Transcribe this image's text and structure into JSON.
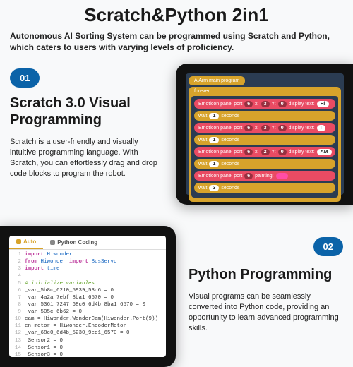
{
  "title": "Scratch&Python 2in1",
  "subtitle": "Autonomous AI Sorting System can be programmed using Scratch and Python, which caters to users with varying levels of proficiency.",
  "section1": {
    "badge": "01",
    "heading": "Scratch 3.0 Visual Programming",
    "body": "Scratch is a user-friendly and visually intuitive programming language. With Scratch, you can effortlessly drag and drop code blocks to program the robot."
  },
  "scratch": {
    "program_title": "AiArm main program",
    "forever": "forever",
    "blocks": [
      {
        "type": "emoticon",
        "port": "6",
        "x": "3",
        "y": "0",
        "text_label": "display text:",
        "text": "Hi"
      },
      {
        "type": "wait",
        "secs": "1"
      },
      {
        "type": "emoticon",
        "port": "6",
        "x": "3",
        "y": "0",
        "text_label": "display text:",
        "text": "I"
      },
      {
        "type": "wait",
        "secs": "1"
      },
      {
        "type": "emoticon",
        "port": "6",
        "x": "2",
        "y": "0",
        "text_label": "display text:",
        "text": "AM"
      },
      {
        "type": "wait",
        "secs": "1"
      },
      {
        "type": "paint",
        "port": "6",
        "label": "painting:"
      },
      {
        "type": "wait",
        "secs": "3"
      }
    ],
    "emoticon_label": "Emoticon panel port",
    "wait_label": "wait",
    "seconds_label": "seconds"
  },
  "python": {
    "tabs": {
      "auto": "Auto",
      "coding": "Python Coding"
    },
    "lines": [
      {
        "n": "1",
        "kw": "import",
        "rest": " Hiwonder"
      },
      {
        "n": "2",
        "kw": "from",
        "mid": " Hiwonder ",
        "kw2": "import",
        "rest2": " BusServo"
      },
      {
        "n": "3",
        "kw": "import",
        "rest": " time"
      },
      {
        "n": "4",
        "plain": ""
      },
      {
        "n": "5",
        "com": "# initialize variables"
      },
      {
        "n": "6",
        "plain": "_var_5b8c_6210_5939_53d6 = 0"
      },
      {
        "n": "7",
        "plain": "_var_4a2a_7ebf_8ba1_6570 = 0"
      },
      {
        "n": "8",
        "plain": "_var_5361_7247_68c0_6d4b_8ba1_6570 = 0"
      },
      {
        "n": "9",
        "plain": "_var_505c_6b62 = 0"
      },
      {
        "n": "10",
        "plain": "cam = Hiwonder.WonderCam(Hiwonder.Port(9))"
      },
      {
        "n": "11",
        "plain": "en_motor = Hiwonder.EncoderMotor"
      },
      {
        "n": "12",
        "plain": "_var_68c0_6d4b_5230_9ed1_6570 = 0"
      },
      {
        "n": "13",
        "plain": "_Sensor2 = 0"
      },
      {
        "n": "14",
        "plain": "_Sensor1 = 0"
      },
      {
        "n": "15",
        "plain": "_Sensor3 = 0"
      }
    ]
  },
  "section2": {
    "badge": "02",
    "heading": "Python Programming",
    "body": "Visual programs can be seamlessly converted into Python code, providing an opportunity to learn advanced programming skills."
  }
}
